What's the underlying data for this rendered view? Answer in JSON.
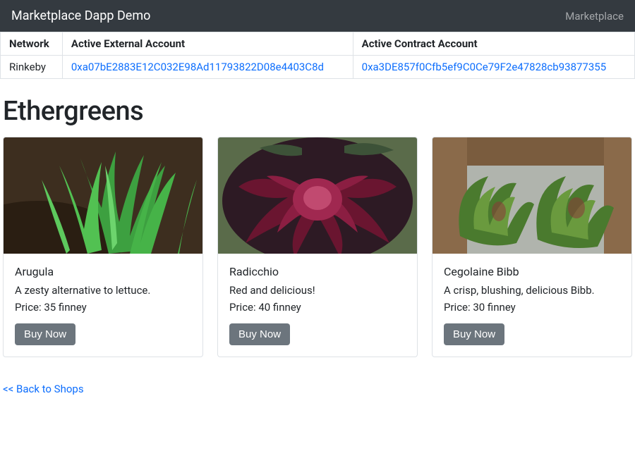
{
  "navbar": {
    "brand": "Marketplace Dapp Demo",
    "link": "Marketplace"
  },
  "accounts": {
    "headers": {
      "network": "Network",
      "external": "Active External Account",
      "contract": "Active Contract Account"
    },
    "row": {
      "network": "Rinkeby",
      "external": "0xa07bE2883E12C032E98Ad11793822D08e4403C8d",
      "contract": "0xa3DE857f0Cfb5ef9C0Ce79F2e47828cb93877355"
    }
  },
  "shop": {
    "title": "Ethergreens",
    "products": [
      {
        "name": "Arugula",
        "description": "A zesty alternative to lettuce.",
        "price_label": "Price: 35 finney",
        "buy_label": "Buy Now"
      },
      {
        "name": "Radicchio",
        "description": "Red and delicious!",
        "price_label": "Price: 40 finney",
        "buy_label": "Buy Now"
      },
      {
        "name": "Cegolaine Bibb",
        "description": "A crisp, blushing, delicious Bibb.",
        "price_label": "Price: 30 finney",
        "buy_label": "Buy Now"
      }
    ]
  },
  "back_link": "<< Back to Shops"
}
